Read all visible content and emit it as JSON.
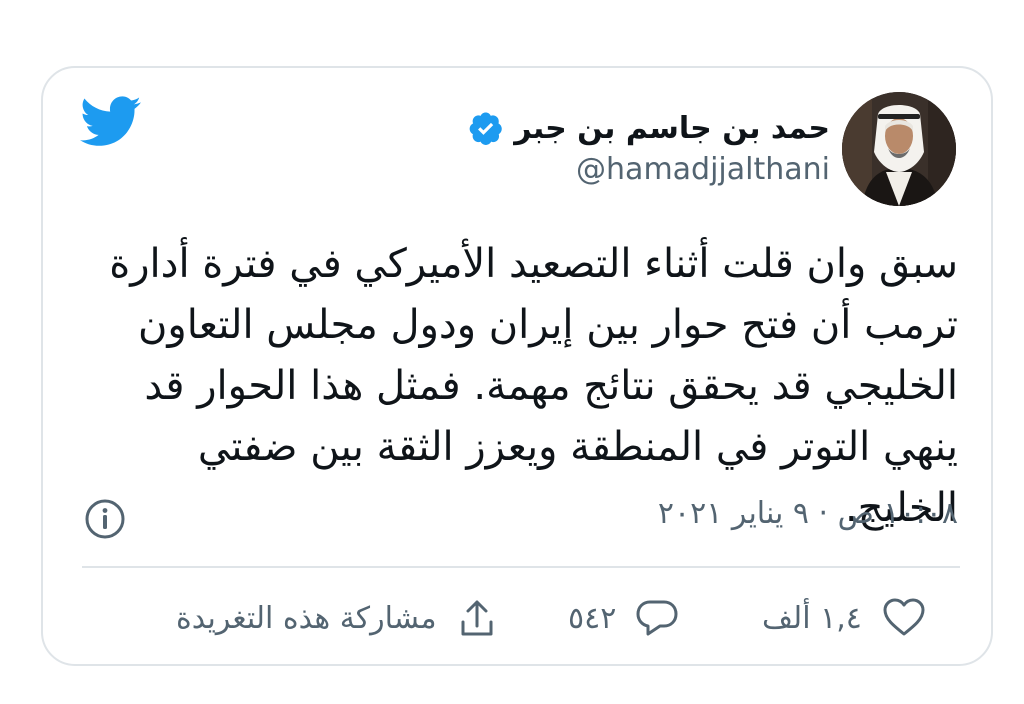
{
  "tweet": {
    "display_name": "حمد بن جاسم بن جبر",
    "handle": "@hamadjjalthani",
    "text": "سبق وان قلت أثناء التصعيد الأميركي في فترة أدارة ترمب أن فتح حوار بين إيران ودول مجلس التعاون الخليجي قد يحقق نتائج مهمة. فمثل هذا الحوار قد ينهي التوتر في المنطقة ويعزز الثقة بين ضفتي الخليج.",
    "timestamp": "١٠:٠٨ ص · ٩ يناير ٢٠٢١"
  },
  "actions": {
    "likes": "١,٤ ألف",
    "replies": "٥٤٢",
    "share_label": "مشاركة هذه التغريدة"
  },
  "icons": {
    "logo": "twitter-bird-icon",
    "verified": "verified-badge-icon",
    "info": "info-icon",
    "like": "heart-icon",
    "reply": "speech-bubble-icon",
    "share": "share-arrow-icon"
  },
  "colors": {
    "twitter_blue": "#1d9bf0",
    "text_primary": "#0f1419",
    "text_secondary": "#536471",
    "border": "#dfe4e8"
  }
}
